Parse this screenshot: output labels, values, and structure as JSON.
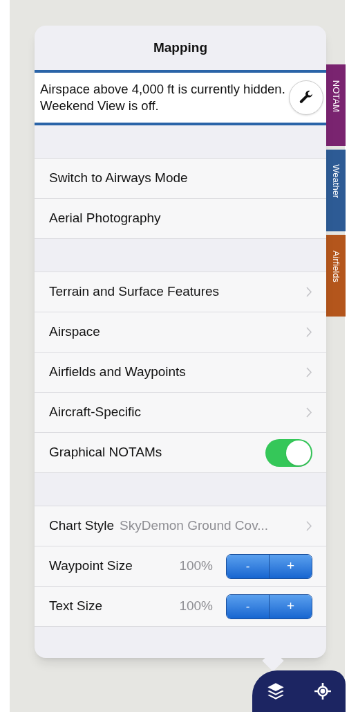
{
  "side_tabs": [
    {
      "label": "NOTAM",
      "color": "#7a2470"
    },
    {
      "label": "Weather",
      "color": "#2d5b95"
    },
    {
      "label": "Airfields",
      "color": "#b4561c"
    }
  ],
  "popover": {
    "title": "Mapping",
    "banner": "Airspace above 4,000 ft is currently hidden. Weekend View is off.",
    "sections": [
      {
        "rows": [
          {
            "kind": "action",
            "label": "Switch to Airways Mode"
          },
          {
            "kind": "action",
            "label": "Aerial Photography"
          }
        ]
      },
      {
        "rows": [
          {
            "kind": "link",
            "label": "Terrain and Surface Features"
          },
          {
            "kind": "link",
            "label": "Airspace"
          },
          {
            "kind": "link",
            "label": "Airfields and Waypoints"
          },
          {
            "kind": "link",
            "label": "Aircraft-Specific"
          },
          {
            "kind": "toggle",
            "label": "Graphical NOTAMs",
            "on": true
          }
        ]
      },
      {
        "rows": [
          {
            "kind": "select",
            "label": "Chart Style",
            "value": "SkyDemon Ground Cov..."
          },
          {
            "kind": "stepper",
            "label": "Waypoint Size",
            "value": "100%",
            "minus": "-",
            "plus": "+"
          },
          {
            "kind": "stepper",
            "label": "Text Size",
            "value": "100%",
            "minus": "-",
            "plus": "+"
          }
        ]
      }
    ]
  }
}
